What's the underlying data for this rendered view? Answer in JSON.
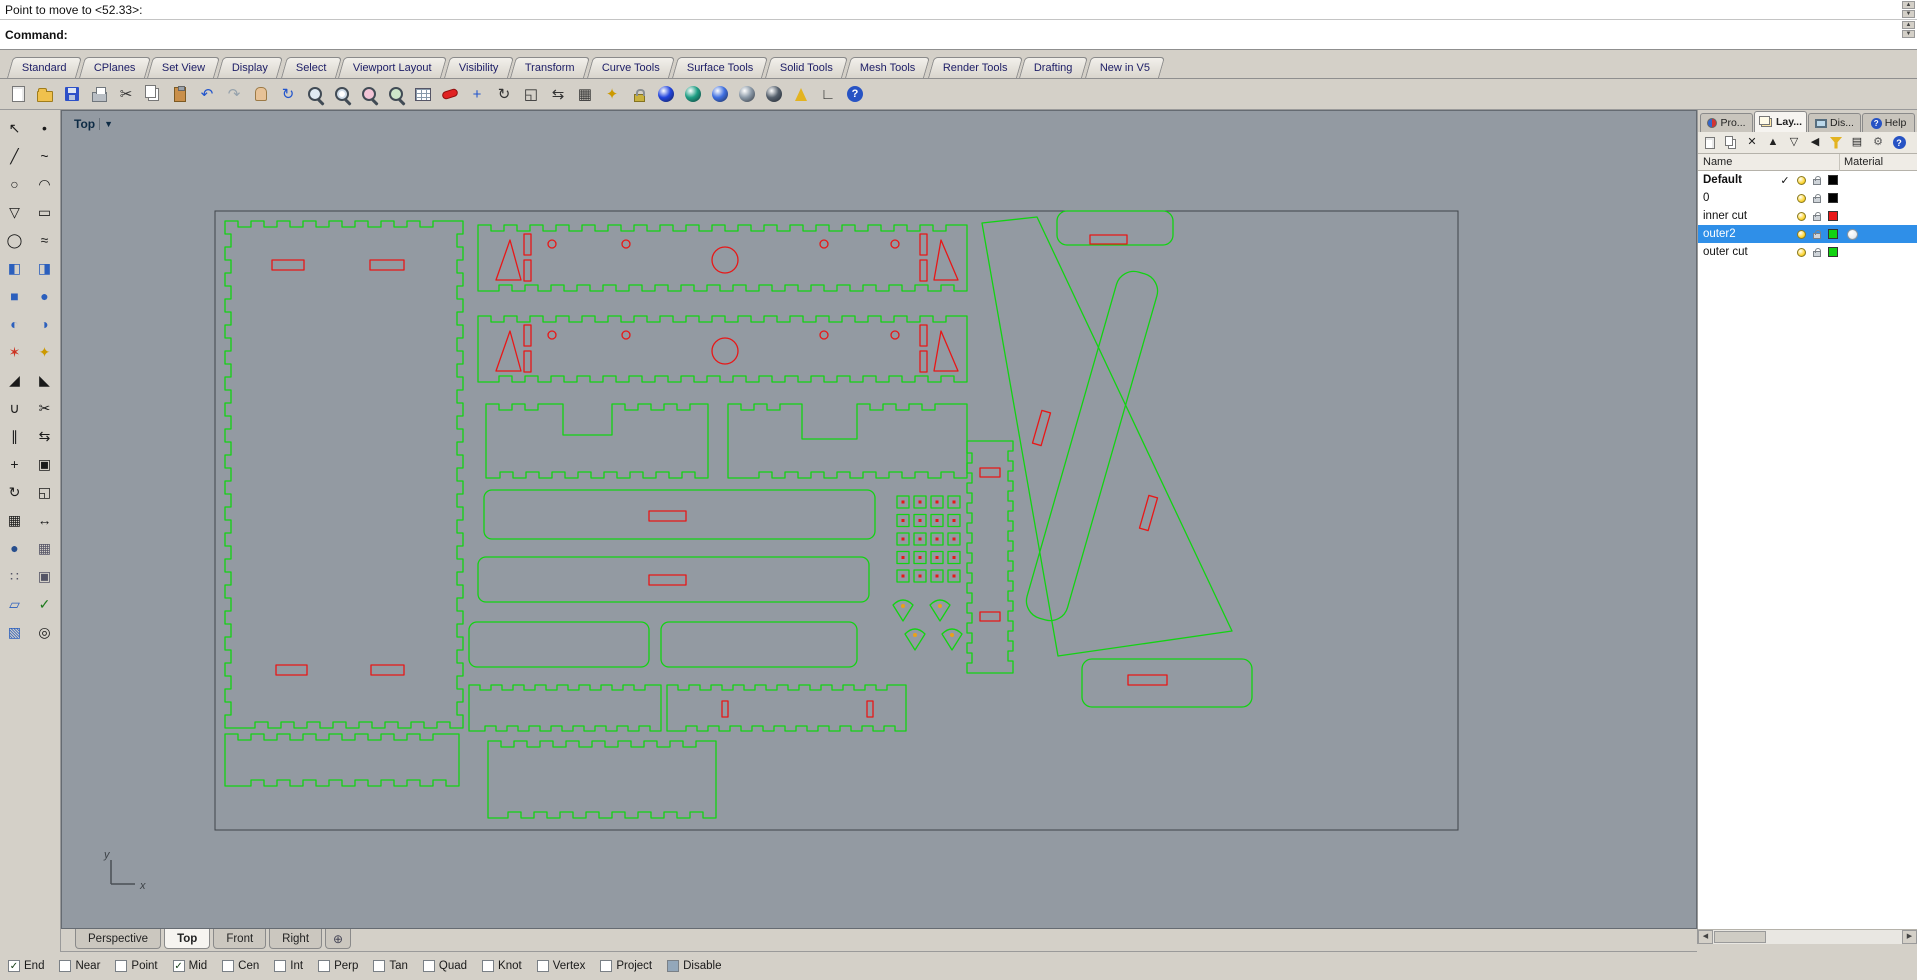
{
  "icons": {
    "up": "▲",
    "down": "▼",
    "left": "◀",
    "right": "▶",
    "check": "✓",
    "dropdown": "▼"
  },
  "colors": {
    "outer_cut": "#12d312",
    "inner_cut": "#e81717",
    "viewport_bg": "#939aa2",
    "frame": "#3f444a",
    "selection": "#2f8fe8"
  },
  "command_area": {
    "history_line": "Point to move to <52.33>:",
    "prompt": "Command:"
  },
  "menu_tabs": [
    "Standard",
    "CPlanes",
    "Set View",
    "Display",
    "Select",
    "Viewport Layout",
    "Visibility",
    "Transform",
    "Curve Tools",
    "Surface Tools",
    "Solid Tools",
    "Mesh Tools",
    "Render Tools",
    "Drafting",
    "New in V5"
  ],
  "toolbar": {
    "icons": [
      {
        "name": "new-file-icon",
        "kind": "page"
      },
      {
        "name": "open-file-icon",
        "kind": "folder"
      },
      {
        "name": "save-file-icon",
        "kind": "floppy"
      },
      {
        "name": "print-icon",
        "kind": "printer"
      },
      {
        "name": "cut-icon",
        "kind": "glyph",
        "glyph": "✂",
        "color": "#333"
      },
      {
        "name": "copy-icon",
        "kind": "copy"
      },
      {
        "name": "paste-icon",
        "kind": "clip"
      },
      {
        "name": "undo-icon",
        "kind": "glyph",
        "glyph": "↶",
        "color": "#2255cc"
      },
      {
        "name": "redo-icon",
        "kind": "glyph",
        "glyph": "↷",
        "color": "#96a2ac"
      },
      {
        "name": "pan-icon",
        "kind": "hand"
      },
      {
        "name": "rotate-view-icon",
        "kind": "glyph",
        "glyph": "↻",
        "color": "#2255cc"
      },
      {
        "name": "zoom-dynamic-icon",
        "kind": "mag"
      },
      {
        "name": "zoom-window-icon",
        "kind": "magwin"
      },
      {
        "name": "zoom-selected-icon",
        "kind": "magsel"
      },
      {
        "name": "zoom-extents-icon",
        "kind": "magext"
      },
      {
        "name": "layer-table-icon",
        "kind": "table"
      },
      {
        "name": "delete-icon",
        "kind": "eraser"
      },
      {
        "name": "move-icon",
        "kind": "glyph",
        "glyph": "+",
        "color": "#2255cc"
      },
      {
        "name": "rotate-icon",
        "kind": "glyph",
        "glyph": "↻",
        "color": "#333"
      },
      {
        "name": "scale-icon",
        "kind": "glyph",
        "glyph": "◱",
        "color": "#333"
      },
      {
        "name": "mirror-icon",
        "kind": "glyph",
        "glyph": "⇆",
        "color": "#333"
      },
      {
        "name": "array-icon",
        "kind": "glyph",
        "glyph": "▦",
        "color": "#333"
      },
      {
        "name": "snapshot-icon",
        "kind": "glyph",
        "glyph": "✦",
        "color": "#cc9900"
      },
      {
        "name": "lock-icon",
        "kind": "lock"
      },
      {
        "name": "render-icon",
        "kind": "ball",
        "color": "#2244dd"
      },
      {
        "name": "shaded-view-icon",
        "kind": "ball",
        "color": "#1e9e84"
      },
      {
        "name": "rendered-view-icon",
        "kind": "ball",
        "color": "#3f6fe0"
      },
      {
        "name": "ghosted-view-icon",
        "kind": "ball",
        "color": "#8a98a6"
      },
      {
        "name": "xray-view-icon",
        "kind": "ball",
        "color": "#55606c"
      },
      {
        "name": "cone-flag-icon",
        "kind": "cone"
      },
      {
        "name": "cplane-icon",
        "kind": "glyph",
        "glyph": "∟",
        "color": "#333"
      },
      {
        "name": "help-icon",
        "kind": "help"
      }
    ]
  },
  "sidebar": {
    "icons": [
      {
        "name": "select-icon",
        "glyph": "↖",
        "color": "#1a1a1a"
      },
      {
        "name": "point-icon",
        "glyph": "•",
        "color": "#1a1a1a"
      },
      {
        "name": "polyline-icon",
        "glyph": "╱",
        "color": "#1a1a1a"
      },
      {
        "name": "curve-icon",
        "glyph": "~",
        "color": "#1a1a1a"
      },
      {
        "name": "circle-icon",
        "glyph": "○",
        "color": "#1a1a1a"
      },
      {
        "name": "arc-icon",
        "glyph": "◠",
        "color": "#1a1a1a"
      },
      {
        "name": "polygon-icon",
        "glyph": "▽",
        "color": "#1a1a1a"
      },
      {
        "name": "rectangle-icon",
        "glyph": "▭",
        "color": "#1a1a1a"
      },
      {
        "name": "ellipse-icon",
        "glyph": "◯",
        "color": "#1a1a1a"
      },
      {
        "name": "offset-icon",
        "glyph": "≈",
        "color": "#1a1a1a"
      },
      {
        "name": "surface-icon",
        "glyph": "◧",
        "color": "#2b5fbd"
      },
      {
        "name": "loft-icon",
        "glyph": "◨",
        "color": "#2b5fbd"
      },
      {
        "name": "box-icon",
        "glyph": "■",
        "color": "#2b5fbd"
      },
      {
        "name": "sphere-icon",
        "glyph": "●",
        "color": "#2b5fbd"
      },
      {
        "name": "boolean-union-icon",
        "glyph": "◐",
        "color": "#2b5fbd"
      },
      {
        "name": "boolean-difference-icon",
        "glyph": "◑",
        "color": "#2b5fbd"
      },
      {
        "name": "explode-icon",
        "glyph": "✶",
        "color": "#cc3322"
      },
      {
        "name": "extrude-icon",
        "glyph": "✦",
        "color": "#cc9900"
      },
      {
        "name": "fillet-icon",
        "glyph": "◢",
        "color": "#1a1a1a"
      },
      {
        "name": "chamfer-icon",
        "glyph": "◣",
        "color": "#1a1a1a"
      },
      {
        "name": "join-icon",
        "glyph": "∪",
        "color": "#1a1a1a"
      },
      {
        "name": "trim-icon",
        "glyph": "✂",
        "color": "#1a1a1a"
      },
      {
        "name": "split-icon",
        "glyph": "∥",
        "color": "#1a1a1a"
      },
      {
        "name": "mirror-object-icon",
        "glyph": "⇆",
        "color": "#1a1a1a"
      },
      {
        "name": "move-object-icon",
        "glyph": "+",
        "color": "#1a1a1a"
      },
      {
        "name": "copy-object-icon",
        "glyph": "▣",
        "color": "#1a1a1a"
      },
      {
        "name": "rotate-object-icon",
        "glyph": "↻",
        "color": "#1a1a1a"
      },
      {
        "name": "scale-object-icon",
        "glyph": "◱",
        "color": "#1a1a1a"
      },
      {
        "name": "array-object-icon",
        "glyph": "▦",
        "color": "#1a1a1a"
      },
      {
        "name": "dimension-icon",
        "glyph": "↔",
        "color": "#1a1a1a"
      },
      {
        "name": "solid-sphere-icon",
        "glyph": "●",
        "color": "#274e8d"
      },
      {
        "name": "grid-icon",
        "glyph": "▦",
        "color": "#556"
      },
      {
        "name": "dot-grid-icon",
        "glyph": "∷",
        "color": "#556"
      },
      {
        "name": "block-icon",
        "glyph": "▣",
        "color": "#556"
      },
      {
        "name": "plane-icon",
        "glyph": "▱",
        "color": "#2b5fbd"
      },
      {
        "name": "check-icon",
        "glyph": "✓",
        "color": "#1c7a1c"
      },
      {
        "name": "wirecube-icon",
        "glyph": "▧",
        "color": "#2b5fbd"
      },
      {
        "name": "osnap-magnet-icon",
        "glyph": "◎",
        "color": "#1a1a1a"
      }
    ]
  },
  "viewport": {
    "label": "Top",
    "axis_x": "x",
    "axis_y": "y"
  },
  "right_panel": {
    "tabs": [
      {
        "label": "Pro...",
        "icon": "pro",
        "active": false
      },
      {
        "label": "Lay...",
        "icon": "lay",
        "active": true
      },
      {
        "label": "Dis...",
        "icon": "dis",
        "active": false
      },
      {
        "label": "Help",
        "icon": "help",
        "active": false
      }
    ],
    "toolbar_icons": [
      {
        "name": "new-layer-icon",
        "kind": "page"
      },
      {
        "name": "new-sublayer-icon",
        "kind": "copy"
      },
      {
        "name": "delete-layer-icon",
        "kind": "glyph",
        "glyph": "✕",
        "color": "#222"
      },
      {
        "name": "move-up-icon",
        "kind": "glyph",
        "glyph": "▲",
        "color": "#222"
      },
      {
        "name": "move-down-icon",
        "kind": "glyph",
        "glyph": "▽",
        "color": "#222"
      },
      {
        "name": "expand-icon",
        "kind": "glyph",
        "glyph": "◀",
        "color": "#222"
      },
      {
        "name": "filter-icon",
        "kind": "funnel"
      },
      {
        "name": "layer-list-icon",
        "kind": "glyph",
        "glyph": "▤",
        "color": "#222"
      },
      {
        "name": "layer-tools-icon",
        "kind": "glyph",
        "glyph": "⚙",
        "color": "#555"
      },
      {
        "name": "panel-help-icon",
        "kind": "help"
      }
    ],
    "columns": {
      "name": "Name",
      "material": "Material"
    },
    "layers": [
      {
        "name": "Default",
        "bold": true,
        "current": true,
        "selected": false,
        "color": "#000000",
        "material": false
      },
      {
        "name": "0",
        "bold": false,
        "current": false,
        "selected": false,
        "color": "#000000",
        "material": false
      },
      {
        "name": "inner cut",
        "bold": false,
        "current": false,
        "selected": false,
        "color": "#e81717",
        "material": false
      },
      {
        "name": "outer2",
        "bold": false,
        "current": false,
        "selected": true,
        "color": "#12d312",
        "material": true
      },
      {
        "name": "outer cut",
        "bold": false,
        "current": false,
        "selected": false,
        "color": "#12d312",
        "material": false
      }
    ]
  },
  "viewport_tabs": [
    {
      "label": "Perspective",
      "active": false,
      "icon": false
    },
    {
      "label": "Top",
      "active": true,
      "icon": false
    },
    {
      "label": "Front",
      "active": false,
      "icon": false
    },
    {
      "label": "Right",
      "active": false,
      "icon": false
    },
    {
      "label": "⊕",
      "active": false,
      "icon": true
    }
  ],
  "osnap": {
    "items": [
      {
        "label": "End",
        "checked": true
      },
      {
        "label": "Near",
        "checked": false
      },
      {
        "label": "Point",
        "checked": false
      },
      {
        "label": "Mid",
        "checked": true
      },
      {
        "label": "Cen",
        "checked": false
      },
      {
        "label": "Int",
        "checked": false
      },
      {
        "label": "Perp",
        "checked": false
      },
      {
        "label": "Tan",
        "checked": false
      },
      {
        "label": "Quad",
        "checked": false
      },
      {
        "label": "Knot",
        "checked": false
      },
      {
        "label": "Vertex",
        "checked": false
      },
      {
        "label": "Project",
        "checked": false
      },
      {
        "label": "Disable",
        "checked": false
      }
    ]
  }
}
